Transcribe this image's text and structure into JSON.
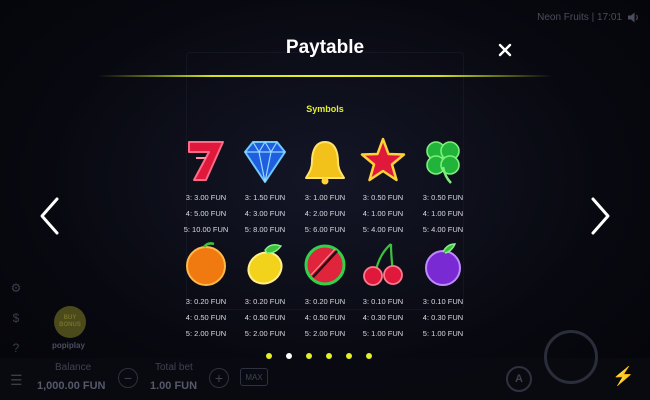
{
  "header": {
    "game_name": "Neon Fruits | 17:01"
  },
  "modal": {
    "title": "Paytable",
    "section_title": "Symbols",
    "rows": [
      [
        {
          "icon": "seven-icon",
          "pays": [
            "3: 3.00 FUN",
            "4: 5.00 FUN",
            "5: 10.00 FUN"
          ]
        },
        {
          "icon": "diamond-icon",
          "pays": [
            "3: 1.50 FUN",
            "4: 3.00 FUN",
            "5: 8.00 FUN"
          ]
        },
        {
          "icon": "bell-icon",
          "pays": [
            "3: 1.00 FUN",
            "4: 2.00 FUN",
            "5: 6.00 FUN"
          ]
        },
        {
          "icon": "star-icon",
          "pays": [
            "3: 0.50 FUN",
            "4: 1.00 FUN",
            "5: 4.00 FUN"
          ]
        },
        {
          "icon": "clover-icon",
          "pays": [
            "3: 0.50 FUN",
            "4: 1.00 FUN",
            "5: 4.00 FUN"
          ]
        }
      ],
      [
        {
          "icon": "orange-icon",
          "pays": [
            "3: 0.20 FUN",
            "4: 0.50 FUN",
            "5: 2.00 FUN"
          ]
        },
        {
          "icon": "lemon-icon",
          "pays": [
            "3: 0.20 FUN",
            "4: 0.50 FUN",
            "5: 2.00 FUN"
          ]
        },
        {
          "icon": "watermelon-icon",
          "pays": [
            "3: 0.20 FUN",
            "4: 0.50 FUN",
            "5: 2.00 FUN"
          ]
        },
        {
          "icon": "cherries-icon",
          "pays": [
            "3: 0.10 FUN",
            "4: 0.30 FUN",
            "5: 1.00 FUN"
          ]
        },
        {
          "icon": "plum-icon",
          "pays": [
            "3: 0.10 FUN",
            "4: 0.30 FUN",
            "5: 1.00 FUN"
          ]
        }
      ]
    ],
    "page_count": 6,
    "active_page": 2
  },
  "left_panel": {
    "buy_bonus_label": "BUY BONUS",
    "brand": "popiplay"
  },
  "bottom_bar": {
    "balance_label": "Balance",
    "balance_value": "1,000.00 FUN",
    "total_bet_label": "Total bet",
    "total_bet_value": "1.00 FUN",
    "max_label": "MAX"
  },
  "colors": {
    "accent_yellow": "#e4f02a",
    "background": "#05060b"
  }
}
